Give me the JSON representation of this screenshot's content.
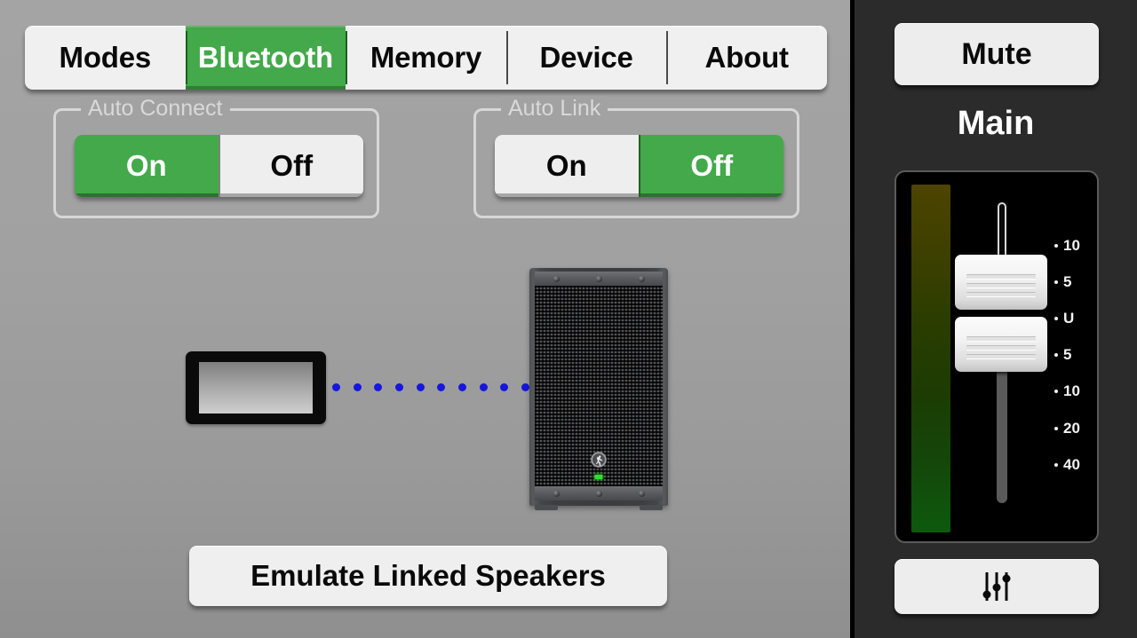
{
  "tabs": [
    {
      "label": "Modes",
      "active": false
    },
    {
      "label": "Bluetooth",
      "active": true
    },
    {
      "label": "Memory",
      "active": false
    },
    {
      "label": "Device",
      "active": false
    },
    {
      "label": "About",
      "active": false
    }
  ],
  "groups": {
    "auto_connect": {
      "legend": "Auto Connect",
      "options": [
        "On",
        "Off"
      ],
      "selected": "On"
    },
    "auto_link": {
      "legend": "Auto Link",
      "options": [
        "On",
        "Off"
      ],
      "selected": "Off"
    }
  },
  "diagram": {
    "tablet_icon": "tablet-device-icon",
    "speaker_icon": "powered-speaker-icon",
    "link_icon": "bluetooth-dotted-link",
    "link_dot_count": 10,
    "speaker_brand_logo": "mackie-running-man-logo",
    "speaker_led_color": "#2ee02e"
  },
  "main_actions": {
    "emulate_label": "Emulate Linked Speakers"
  },
  "sidebar": {
    "mute_label": "Mute",
    "channel_label": "Main",
    "eq_icon": "eq-sliders-icon",
    "fader": {
      "scale_labels": [
        "10",
        "5",
        "U",
        "5",
        "10",
        "20",
        "40"
      ],
      "scale_positions_pct": [
        16,
        26.5,
        37,
        47,
        57.5,
        68,
        78.5
      ],
      "cap_count": 2
    }
  },
  "colors": {
    "accent_green": "#43a94a",
    "panel_gray": "#a2a2a2",
    "sidebar_dark": "#2b2b2b",
    "button_light": "#efefef",
    "link_blue": "#1616dd"
  }
}
